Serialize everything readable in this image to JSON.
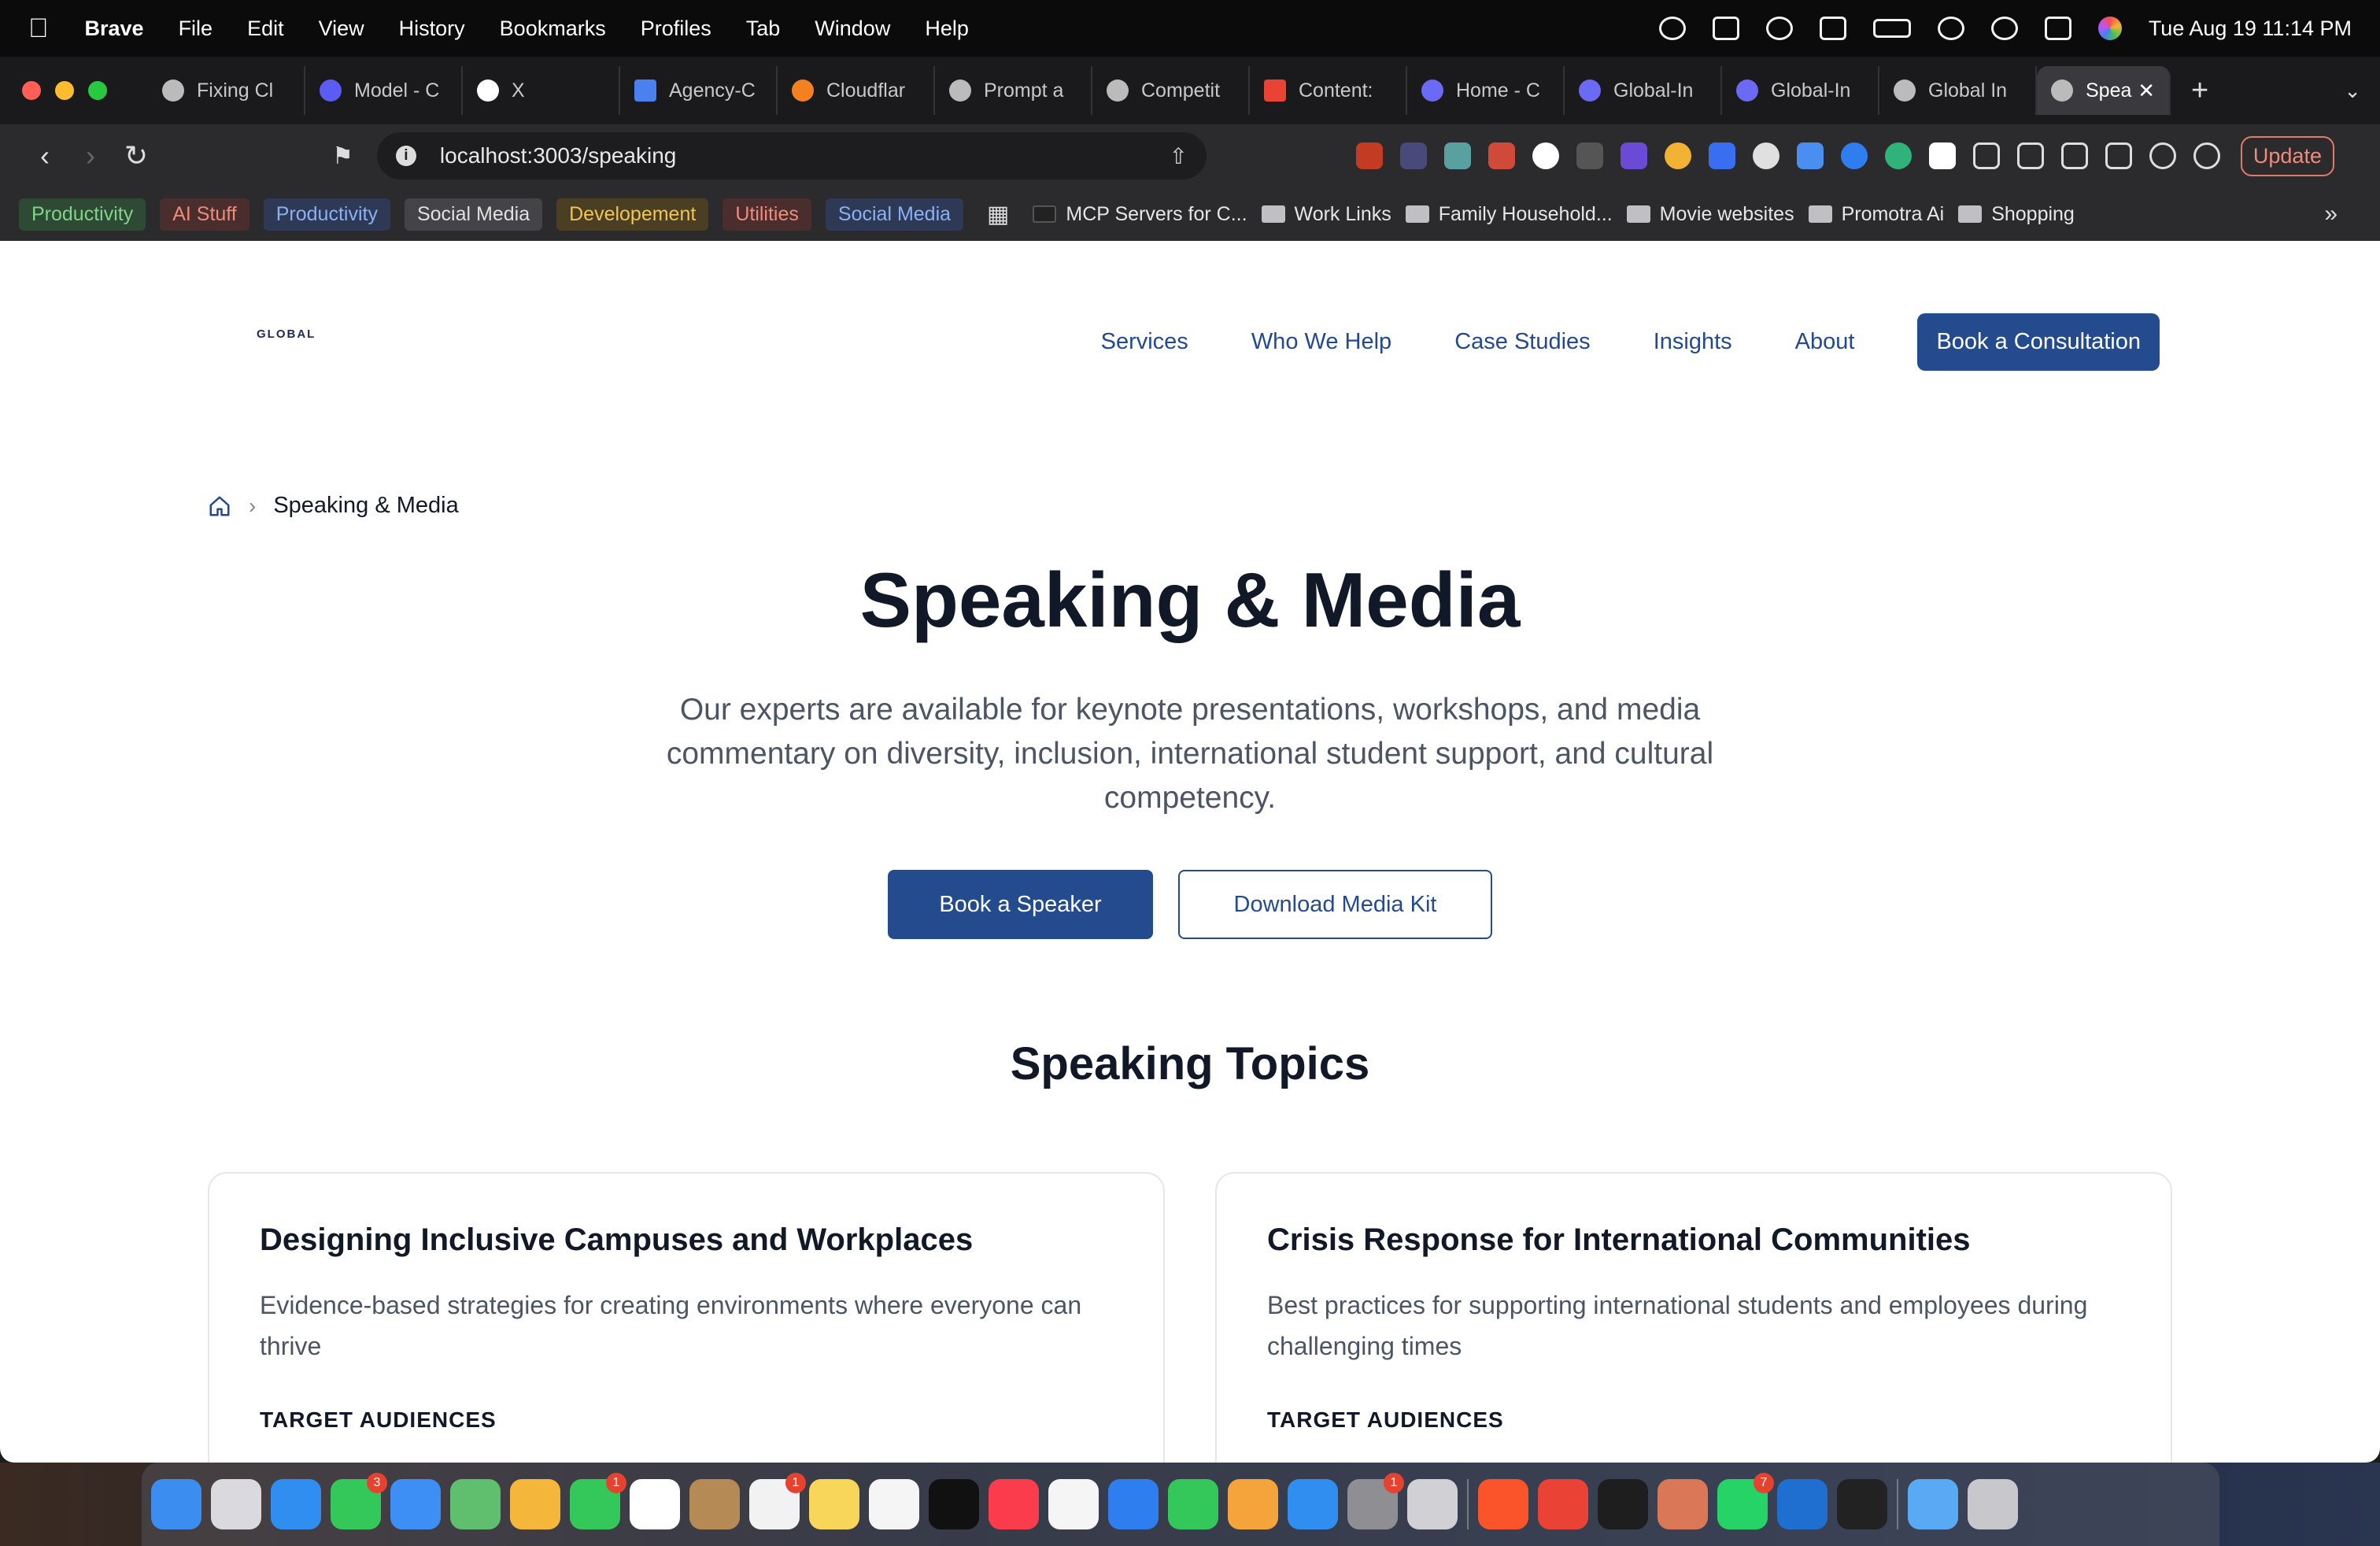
{
  "menubar": {
    "apple": "",
    "app": "Brave",
    "items": [
      "File",
      "Edit",
      "View",
      "History",
      "Bookmarks",
      "Profiles",
      "Tab",
      "Window",
      "Help"
    ],
    "datetime": "Tue Aug 19  11:14 PM"
  },
  "tabs": [
    {
      "label": "Fixing Cl",
      "color": "#bbbbbb"
    },
    {
      "label": "Model - C",
      "color": "#5b5bf5"
    },
    {
      "label": "X",
      "color": "#ffffff"
    },
    {
      "label": "Agency-C",
      "color": "#4a80f0"
    },
    {
      "label": "Cloudflar",
      "color": "#f48120"
    },
    {
      "label": "Prompt a",
      "color": "#bbbbbb"
    },
    {
      "label": "Competit",
      "color": "#bbbbbb"
    },
    {
      "label": "Content:",
      "color": "#ea4335"
    },
    {
      "label": "Home - C",
      "color": "#6a6af5"
    },
    {
      "label": "Global-In",
      "color": "#6a6af5"
    },
    {
      "label": "Global-In",
      "color": "#6a6af5"
    },
    {
      "label": "Global In",
      "color": "#bbbbbb"
    }
  ],
  "active_tab": {
    "label": "Spea",
    "close": "✕"
  },
  "new_tab": "+",
  "toolbar": {
    "url": "localhost:3003/speaking",
    "update": "Update"
  },
  "bookmarks": {
    "chips": [
      {
        "label": "Productivity",
        "bg": "#2f4a34",
        "fg": "#7fd48a"
      },
      {
        "label": "AI Stuff",
        "bg": "#4a2e2e",
        "fg": "#f08a7a"
      },
      {
        "label": "Productivity",
        "bg": "#2e3a55",
        "fg": "#8ab0f5"
      },
      {
        "label": "Social Media",
        "bg": "#444448",
        "fg": "#e0e0e0"
      },
      {
        "label": "Developement",
        "bg": "#4a3f22",
        "fg": "#f2c455"
      },
      {
        "label": "Utilities",
        "bg": "#4a2e2e",
        "fg": "#f08a7a"
      },
      {
        "label": "Social Media",
        "bg": "#2e3a55",
        "fg": "#8ab0f5"
      }
    ],
    "folders": [
      "MCP Servers for C...",
      "Work Links",
      "Family Household...",
      "Movie websites",
      "Promotra Ai",
      "Shopping"
    ],
    "more": "»"
  },
  "site": {
    "logo": "GLOBAL",
    "nav": [
      "Services",
      "Who We Help",
      "Case Studies",
      "Insights",
      "About"
    ],
    "cta": "Book a Consultation",
    "breadcrumb": "Speaking & Media",
    "title": "Speaking & Media",
    "subtitle": "Our experts are available for keynote presentations, workshops, and media commentary on diversity, inclusion, international student support, and cultural competency.",
    "btn_book": "Book a Speaker",
    "btn_media": "Download Media Kit",
    "topics_title": "Speaking Topics",
    "cards": [
      {
        "title": "Designing Inclusive Campuses and Workplaces",
        "desc": "Evidence-based strategies for creating environments where everyone can thrive",
        "label": "TARGET AUDIENCES"
      },
      {
        "title": "Crisis Response for International Communities",
        "desc": "Best practices for supporting international students and employees during challenging times",
        "label": "TARGET AUDIENCES"
      }
    ]
  },
  "dock": {
    "apps": [
      {
        "name": "finder",
        "color": "#3b8df0"
      },
      {
        "name": "launchpad",
        "color": "#d9d9de"
      },
      {
        "name": "safari",
        "color": "#2f8ef0"
      },
      {
        "name": "messages",
        "color": "#34c759",
        "badge": "3"
      },
      {
        "name": "mail",
        "color": "#3d8ef5"
      },
      {
        "name": "maps",
        "color": "#5fbf6f"
      },
      {
        "name": "photos",
        "color": "#f5b73b"
      },
      {
        "name": "facetime",
        "color": "#34c759",
        "badge": "1"
      },
      {
        "name": "calendar",
        "color": "#ffffff"
      },
      {
        "name": "contacts",
        "color": "#b58a55"
      },
      {
        "name": "reminders",
        "color": "#f2f2f2",
        "badge": "1"
      },
      {
        "name": "notes",
        "color": "#f7d65a"
      },
      {
        "name": "freeform",
        "color": "#f5f5f5"
      },
      {
        "name": "tv",
        "color": "#111111"
      },
      {
        "name": "music",
        "color": "#fa3c4c"
      },
      {
        "name": "news",
        "color": "#f5f5f5"
      },
      {
        "name": "keynote",
        "color": "#2f7ef0"
      },
      {
        "name": "numbers",
        "color": "#34c759"
      },
      {
        "name": "pages",
        "color": "#f5a33b"
      },
      {
        "name": "app-store",
        "color": "#2f8ef0"
      },
      {
        "name": "system-settings",
        "color": "#8e8e93",
        "badge": "1"
      },
      {
        "name": "iphone-mirroring",
        "color": "#d0d0d5"
      },
      {
        "name": "brave",
        "color": "#fb542b"
      },
      {
        "name": "chrome",
        "color": "#ea4335"
      },
      {
        "name": "terminal",
        "color": "#1e1e1e"
      },
      {
        "name": "claude",
        "color": "#d97757"
      },
      {
        "name": "whatsapp",
        "color": "#25d366",
        "badge": "7"
      },
      {
        "name": "vscode",
        "color": "#1e6fd0"
      },
      {
        "name": "zed",
        "color": "#222222"
      },
      {
        "name": "downloads-folder",
        "color": "#5aa9f5"
      },
      {
        "name": "trash",
        "color": "#c8c8cc"
      }
    ]
  }
}
